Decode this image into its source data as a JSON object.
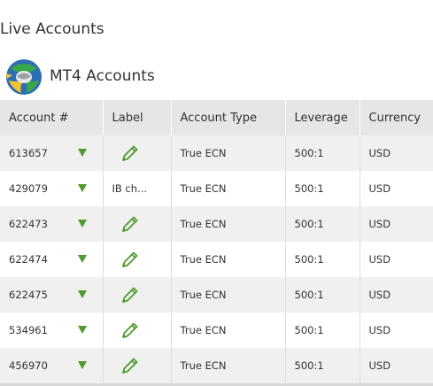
{
  "page": {
    "section_title": "Live Accounts"
  },
  "mt4": {
    "title": "MT4 Accounts",
    "logo_icon": "metatrader4-logo-icon"
  },
  "table": {
    "headers": [
      "Account #",
      "Label",
      "Account Type",
      "Leverage",
      "Currency"
    ],
    "rows": [
      {
        "account": "613657",
        "label": "",
        "type": "True ECN",
        "leverage": "500:1",
        "currency": "USD"
      },
      {
        "account": "429079",
        "label": "IB ch...",
        "type": "True ECN",
        "leverage": "500:1",
        "currency": "USD"
      },
      {
        "account": "622473",
        "label": "",
        "type": "True ECN",
        "leverage": "500:1",
        "currency": "USD"
      },
      {
        "account": "622474",
        "label": "",
        "type": "True ECN",
        "leverage": "500:1",
        "currency": "USD"
      },
      {
        "account": "622475",
        "label": "",
        "type": "True ECN",
        "leverage": "500:1",
        "currency": "USD"
      },
      {
        "account": "534961",
        "label": "",
        "type": "True ECN",
        "leverage": "500:1",
        "currency": "USD"
      },
      {
        "account": "456970",
        "label": "",
        "type": "True ECN",
        "leverage": "500:1",
        "currency": "USD"
      }
    ]
  },
  "colors": {
    "accent_green": "#4f9a2f",
    "header_bg": "#e6e6e6",
    "row_stripe": "#f0f0f0"
  },
  "icons": {
    "expand": "chevron-down-icon",
    "edit": "pencil-icon"
  }
}
